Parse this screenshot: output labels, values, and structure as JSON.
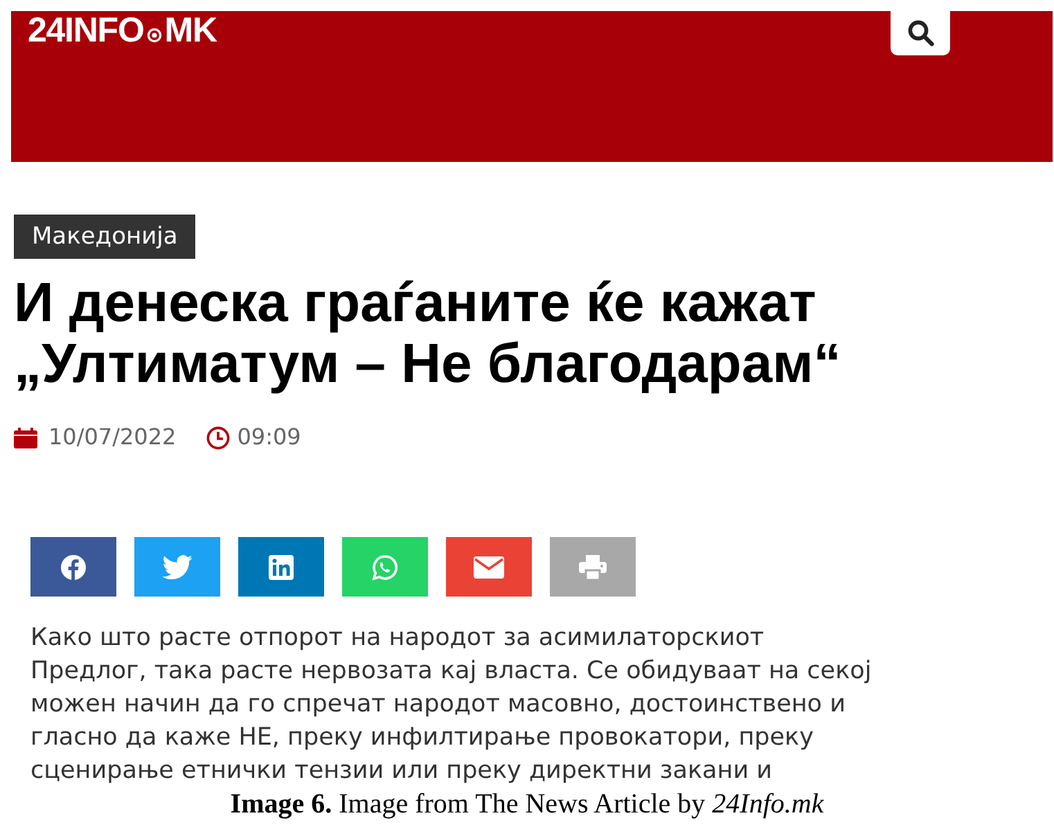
{
  "header": {
    "logo": "24INFO",
    "logo_suffix": "MK"
  },
  "category": "Македонија",
  "title_lines": [
    "И денеска граѓаните ќе кажат",
    "„Ултиматум – Не благодарам“"
  ],
  "date": "10/07/2022",
  "time": "09:09",
  "share_buttons": [
    {
      "kind": "facebook",
      "color": "#3b5998"
    },
    {
      "kind": "twitter",
      "color": "#1da1f2"
    },
    {
      "kind": "linkedin",
      "color": "#0077b5"
    },
    {
      "kind": "whatsapp",
      "color": "#25d366"
    },
    {
      "kind": "email",
      "color": "#ea4335"
    },
    {
      "kind": "print",
      "color": "#a8a8a8"
    }
  ],
  "body_lines": [
    "Како што расте отпорот на народот за асимилаторскиот",
    "Предлог, така расте нервозата кај власта. Се обидуваат на секој",
    "можен начин да го спречат народот масовно, достоинствено и",
    "гласно да каже НЕ, преку инфилтирање провокатори, преку",
    "сценирање етнички тензии или преку директни закани и"
  ],
  "caption": "**Image 6.** Image from The News Article by *24Info.mk*"
}
